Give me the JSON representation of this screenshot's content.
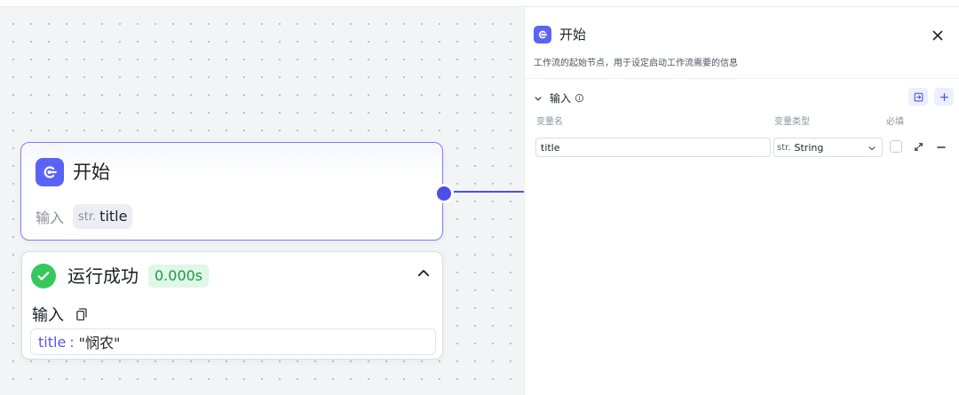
{
  "node": {
    "title": "开始",
    "input_label": "输入",
    "param": {
      "type": "str.",
      "name": "title"
    },
    "icon": "start-icon",
    "accent": "#5b63f6"
  },
  "result": {
    "status": "运行成功",
    "time": "0.000s",
    "input_label": "输入",
    "value_key": "title",
    "value_separator": ":",
    "value": "\"悯农\"",
    "status_color": "#36c85a"
  },
  "panel": {
    "title": "开始",
    "description": "工作流的起始节点，用于设定启动工作流需要的信息",
    "section_title": "输入",
    "columns": {
      "name": "变量名",
      "type": "变量类型",
      "required": "必填"
    },
    "variable": {
      "name": "title",
      "type_prefix": "str.",
      "type": "String",
      "required": false
    }
  },
  "icons": {
    "close": "close-icon",
    "collapse": "chevron-up-icon",
    "copy": "copy-icon",
    "info": "info-icon",
    "import": "import-icon",
    "add": "plus-icon",
    "expand": "expand-icon",
    "remove": "minus-icon"
  }
}
